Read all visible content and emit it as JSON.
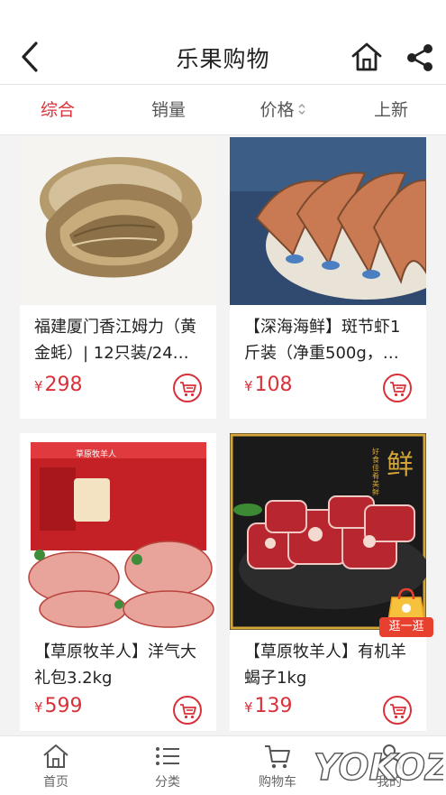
{
  "header": {
    "title": "乐果购物",
    "back_icon": "chevron-left-icon",
    "home_icon": "home-icon",
    "share_icon": "share-icon"
  },
  "sort_tabs": [
    {
      "label": "综合",
      "active": true
    },
    {
      "label": "销量",
      "active": false
    },
    {
      "label": "价格",
      "active": false
    },
    {
      "label": "上新",
      "active": false
    }
  ],
  "products": [
    {
      "name_line1": "福建厦门香江姆力（黄",
      "name_line2": "金蚝）| 12只装/24只...",
      "currency": "¥",
      "price": "298"
    },
    {
      "name_line1": "【深海海鲜】斑节虾1",
      "name_line2": "斤装（净重500g，约...",
      "currency": "¥",
      "price": "108"
    },
    {
      "name_line1": "【草原牧羊人】洋气大",
      "name_line2": "礼包3.2kg",
      "currency": "¥",
      "price": "599"
    },
    {
      "name_line1": "【草原牧羊人】有机羊",
      "name_line2": "蝎子1kg",
      "currency": "¥",
      "price": "139"
    }
  ],
  "image_texts": {
    "gift_box_brand": "草原牧羊人",
    "meat_slogan_char": "鲜",
    "meat_slogan_small": "好食佳肴美鲜"
  },
  "floating_badge": {
    "label": "逛一逛"
  },
  "bottom_nav": [
    {
      "label": "首页",
      "icon": "home-icon"
    },
    {
      "label": "分类",
      "icon": "list-icon"
    },
    {
      "label": "购物车",
      "icon": "cart-icon"
    },
    {
      "label": "我的",
      "icon": "user-icon"
    }
  ],
  "watermark": "YOKOZ",
  "colors": {
    "accent": "#d9313a",
    "text": "#222222",
    "muted": "#666666"
  }
}
